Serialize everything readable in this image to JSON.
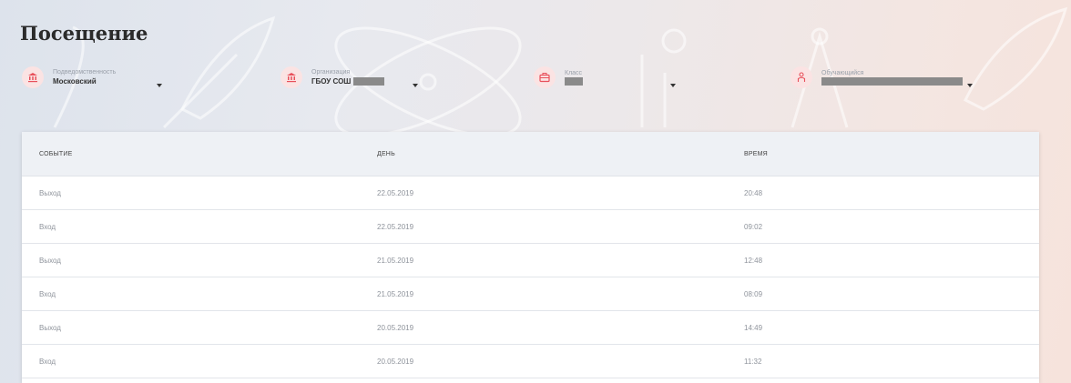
{
  "page": {
    "title": "Посещение"
  },
  "filters": {
    "district": {
      "label": "Подведомственность",
      "value": "Московский"
    },
    "organization": {
      "label": "Организация",
      "value": "ГБОУ СОШ"
    },
    "class": {
      "label": "Класс",
      "value": ""
    },
    "student": {
      "label": "Обучающийся",
      "value": ""
    }
  },
  "table": {
    "columns": [
      "СОБЫТИЕ",
      "ДЕНЬ",
      "ВРЕМЯ"
    ],
    "rows": [
      {
        "event": "Выход",
        "day": "22.05.2019",
        "time": "20:48"
      },
      {
        "event": "Вход",
        "day": "22.05.2019",
        "time": "09:02"
      },
      {
        "event": "Выход",
        "day": "21.05.2019",
        "time": "12:48"
      },
      {
        "event": "Вход",
        "day": "21.05.2019",
        "time": "08:09"
      },
      {
        "event": "Выход",
        "day": "20.05.2019",
        "time": "14:49"
      },
      {
        "event": "Вход",
        "day": "20.05.2019",
        "time": "11:32"
      }
    ]
  },
  "colors": {
    "accent": "#e8505b",
    "icon_bg": "#fbe3e3",
    "header_bg": "#eef1f5"
  },
  "icons": {
    "district": "bank-icon",
    "organization": "bank-icon",
    "class": "briefcase-icon",
    "student": "person-icon"
  }
}
